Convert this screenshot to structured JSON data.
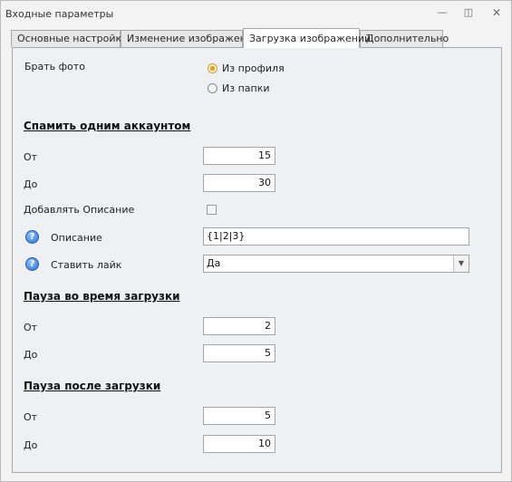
{
  "window": {
    "title": "Входные параметры",
    "min_icon": "—",
    "max_icon": "◫",
    "close_icon": "✕"
  },
  "tabs": [
    {
      "label": "Основные настройки"
    },
    {
      "label": "Изменение изображения"
    },
    {
      "label": "Загрузка изображений"
    },
    {
      "label": "Дополнительно"
    }
  ],
  "photo_source": {
    "label": "Брать фото",
    "options": [
      {
        "label": "Из профиля",
        "selected": true
      },
      {
        "label": "Из папки",
        "selected": false
      }
    ]
  },
  "spam_section": {
    "title": "Спамить одним аккаунтом",
    "from_label": "От",
    "from_value": "15",
    "to_label": "До",
    "to_value": "30",
    "add_description_label": "Добавлять Описание",
    "add_description_checked": false,
    "description_label": "Описание",
    "description_value": "{1|2|3}",
    "like_label": "Ставить лайк",
    "like_value": "Да"
  },
  "pause_during": {
    "title": "Пауза во время загрузки",
    "from_label": "От",
    "from_value": "2",
    "to_label": "До",
    "to_value": "5"
  },
  "pause_after": {
    "title": "Пауза после загрузки",
    "from_label": "От",
    "from_value": "5",
    "to_label": "До",
    "to_value": "10"
  },
  "help_glyph": "?",
  "dropdown_glyph": "▼"
}
